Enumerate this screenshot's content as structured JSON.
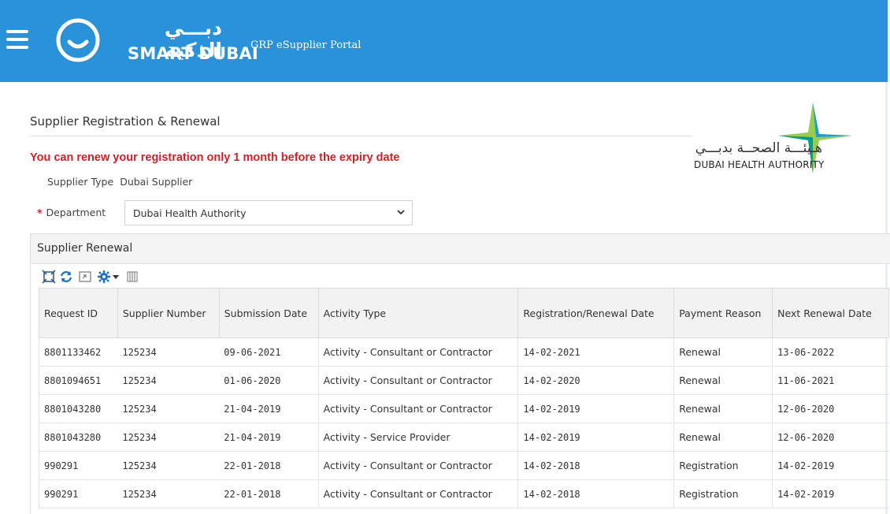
{
  "header": {
    "logo_arabic": "دبـــي الذكية",
    "logo_english": "SMART DUBAI",
    "portal_title": "GRP eSupplier Portal",
    "bg_color": "#2a92d8"
  },
  "page": {
    "title": "Supplier Registration & Renewal",
    "warning": "You can renew your registration only 1 month before the expiry date",
    "warning_color": "#d21f26"
  },
  "authority": {
    "arabic": "هـيئـــة الصحــة بدبـــي",
    "english": "DUBAI HEALTH AUTHORITY"
  },
  "form": {
    "supplier_type_label": "Supplier Type",
    "supplier_type_value": "Dubai Supplier",
    "required_marker": "*",
    "department_label": "Department",
    "department_value": "Dubai Health Authority"
  },
  "panel": {
    "title": "Supplier Renewal",
    "toolbar_icons": [
      "detach-icon",
      "refresh-icon",
      "export-icon",
      "gear-icon",
      "dropdown-arrow-icon",
      "freeze-columns-icon"
    ]
  },
  "table": {
    "columns": [
      "Request ID",
      "Supplier Number",
      "Submission Date",
      "Activity Type",
      "Registration/Renewal Date",
      "Payment Reason",
      "Next Renewal Date"
    ],
    "rows": [
      [
        "8801133462",
        "125234",
        "09-06-2021",
        "Activity - Consultant or Contractor",
        "14-02-2021",
        "Renewal",
        "13-06-2022"
      ],
      [
        "8801094651",
        "125234",
        "01-06-2020",
        "Activity - Consultant or Contractor",
        "14-02-2020",
        "Renewal",
        "11-06-2021"
      ],
      [
        "8801043280",
        "125234",
        "21-04-2019",
        "Activity - Consultant or Contractor",
        "14-02-2019",
        "Renewal",
        "12-06-2020"
      ],
      [
        "8801043280",
        "125234",
        "21-04-2019",
        "Activity - Service Provider",
        "14-02-2019",
        "Renewal",
        "12-06-2020"
      ],
      [
        "990291",
        "125234",
        "22-01-2018",
        "Activity - Consultant or Contractor",
        "14-02-2018",
        "Registration",
        "14-02-2019"
      ],
      [
        "990291",
        "125234",
        "22-01-2018",
        "Activity - Consultant or Contractor",
        "14-02-2018",
        "Registration",
        "14-02-2019"
      ]
    ]
  }
}
